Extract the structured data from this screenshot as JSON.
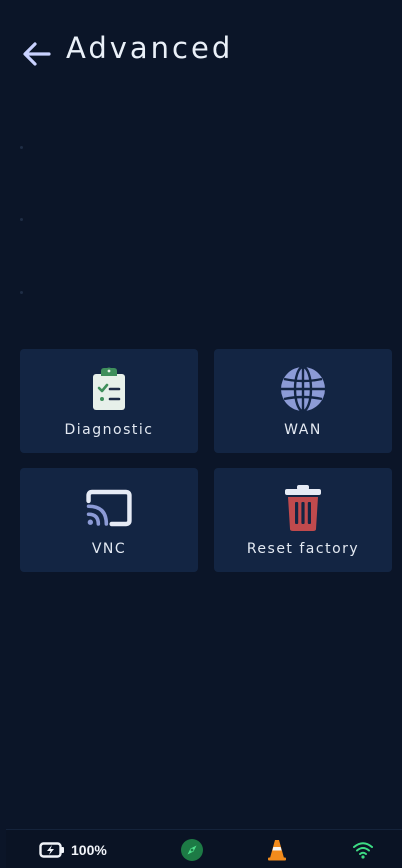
{
  "header": {
    "title": "Advanced",
    "back_icon": "arrow-left-icon"
  },
  "tiles": [
    {
      "label": "Diagnostic",
      "icon": "clipboard-check-icon"
    },
    {
      "label": "WAN",
      "icon": "globe-icon"
    },
    {
      "label": "VNC",
      "icon": "cast-icon"
    },
    {
      "label": "Reset factory",
      "icon": "trash-icon"
    }
  ],
  "status_bar": {
    "battery_text": "100%",
    "battery_icon": "battery-charging-icon",
    "compass_icon": "compass-icon",
    "cone_icon": "traffic-cone-icon",
    "wifi_icon": "wifi-icon"
  },
  "colors": {
    "background": "#0b1528",
    "tile": "#132543",
    "accent_back": "#c9d2ff",
    "clipboard": "#e7f0ea",
    "clipboard_clip": "#3f8f5c",
    "globe": "#8c9bd6",
    "cast": "#e6ebf5",
    "cast_waves": "#8c9bd6",
    "trash": "#c04a4d",
    "compass_bg": "#1d7a45",
    "cone": "#f28b1c",
    "wifi": "#3ddc84"
  }
}
